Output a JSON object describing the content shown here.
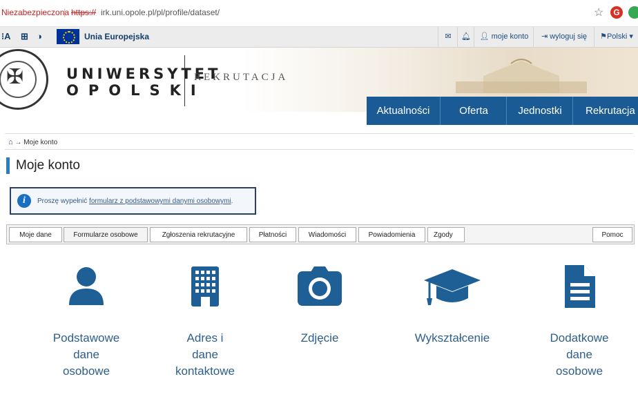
{
  "browser": {
    "insecure_label": "Niezabezpieczona",
    "separator": "|",
    "url_scheme": "https://",
    "url_rest": "irk.uni.opole.pl/pl/profile/dataset/"
  },
  "utility_bar": {
    "accessibility": "A",
    "eu_label": "Unia Europejska",
    "my_account": "moje konto",
    "logout": "wyloguj się",
    "language": "Polski"
  },
  "header": {
    "uni_line1": "UNIWERSYTET",
    "uni_line2": "OPOLSKI",
    "section": "REKRUTACJA",
    "nav": [
      "Aktualności",
      "Oferta",
      "Jednostki",
      "Rekrutacja"
    ]
  },
  "breadcrumb": {
    "current": "Moje konto"
  },
  "page_title": "Moje konto",
  "info": {
    "prefix": "Proszę wypełnić",
    "link": "formularz z podstawowymi danymi osobowymi",
    "suffix": "."
  },
  "tabs": [
    "Moje dane",
    "Formularze osobowe",
    "Zgłoszenia rekrutacyjne",
    "Płatności",
    "Wiadomości",
    "Powiadomienia",
    "Zgody",
    "Pomoc"
  ],
  "tiles": [
    {
      "icon": "person-icon",
      "lines": [
        "Podstawowe",
        "dane",
        "osobowe"
      ]
    },
    {
      "icon": "building-icon",
      "lines": [
        "Adres i",
        "dane",
        "kontaktowe"
      ]
    },
    {
      "icon": "camera-icon",
      "lines": [
        "Zdjęcie"
      ]
    },
    {
      "icon": "graduation-cap-icon",
      "lines": [
        "Wykształcenie"
      ]
    },
    {
      "icon": "document-icon",
      "lines": [
        "Dodatkowe",
        "dane",
        "osobowe"
      ]
    }
  ],
  "colors": {
    "nav_bg": "#1a5a95",
    "icon_blue": "#1e5f96",
    "label_blue": "#2e5f8a"
  }
}
